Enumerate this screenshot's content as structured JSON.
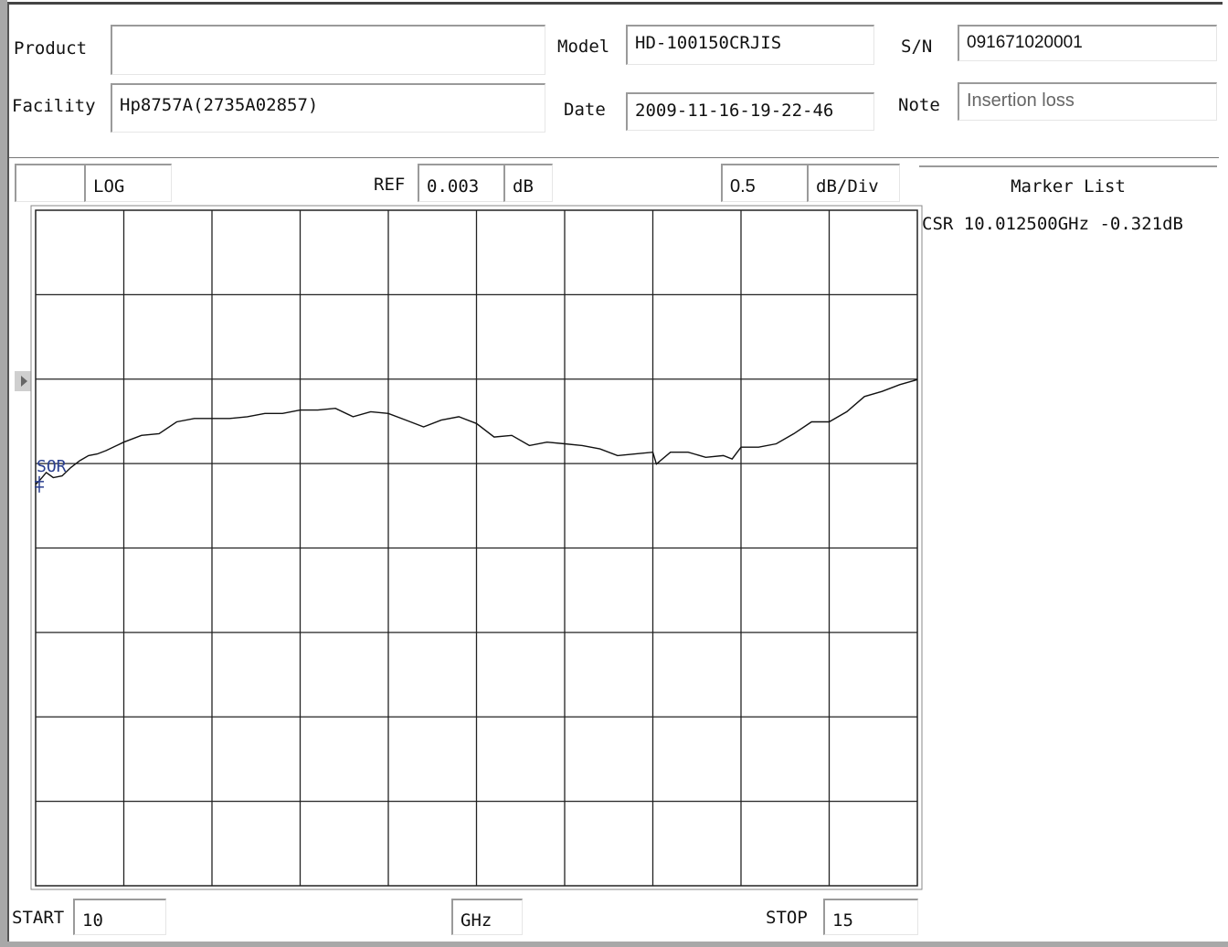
{
  "header": {
    "product_label": "Product",
    "product_value": "",
    "model_label": "Model",
    "model_value": "HD-100150CRJIS",
    "sn_label": "S/N",
    "sn_value": "091671020001",
    "facility_label": "Facility",
    "facility_value": "Hp8757A(2735A02857)",
    "date_label": "Date",
    "date_value": "2009-11-16-19-22-46",
    "note_label": "Note",
    "note_value": "Insertion loss"
  },
  "scale": {
    "channel_value": "",
    "format_value": "LOG",
    "ref_label": "REF",
    "ref_value": "0.003",
    "ref_unit": "dB",
    "div_value": "0.5",
    "div_unit": "dB/Div"
  },
  "marker_list": {
    "title": "Marker List",
    "items": [
      "CSR 10.012500GHz -0.321dB"
    ]
  },
  "footer": {
    "start_label": "START",
    "start_value": "10",
    "unit_value": "GHz",
    "stop_label": "STOP",
    "stop_value": "15"
  },
  "chart_data": {
    "type": "line",
    "x_unit": "GHz",
    "y_unit": "dB",
    "xlim": [
      10,
      15
    ],
    "ylim": [
      -2.997,
      1.003
    ],
    "grid": true,
    "reference_level": 0.003,
    "cursor_label": "SOR",
    "x": [
      10.0,
      10.02,
      10.06,
      10.1,
      10.15,
      10.2,
      10.25,
      10.3,
      10.35,
      10.4,
      10.5,
      10.6,
      10.7,
      10.8,
      10.9,
      11.0,
      11.1,
      11.2,
      11.3,
      11.4,
      11.5,
      11.6,
      11.7,
      11.8,
      11.9,
      12.0,
      12.1,
      12.2,
      12.3,
      12.4,
      12.5,
      12.6,
      12.7,
      12.8,
      12.9,
      13.0,
      13.1,
      13.2,
      13.3,
      13.4,
      13.5,
      13.52,
      13.6,
      13.7,
      13.8,
      13.9,
      13.95,
      14.0,
      14.1,
      14.2,
      14.3,
      14.4,
      14.5,
      14.6,
      14.7,
      14.8,
      14.9,
      15.0
    ],
    "y": [
      -0.62,
      -0.6,
      -0.55,
      -0.58,
      -0.57,
      -0.52,
      -0.48,
      -0.45,
      -0.44,
      -0.42,
      -0.37,
      -0.33,
      -0.32,
      -0.25,
      -0.23,
      -0.23,
      -0.23,
      -0.22,
      -0.2,
      -0.2,
      -0.18,
      -0.18,
      -0.17,
      -0.22,
      -0.19,
      -0.2,
      -0.24,
      -0.28,
      -0.24,
      -0.22,
      -0.26,
      -0.34,
      -0.33,
      -0.39,
      -0.37,
      -0.38,
      -0.39,
      -0.41,
      -0.45,
      -0.44,
      -0.43,
      -0.5,
      -0.43,
      -0.43,
      -0.46,
      -0.45,
      -0.47,
      -0.4,
      -0.4,
      -0.38,
      -0.32,
      -0.25,
      -0.25,
      -0.19,
      -0.1,
      -0.07,
      -0.03,
      0.0
    ]
  }
}
